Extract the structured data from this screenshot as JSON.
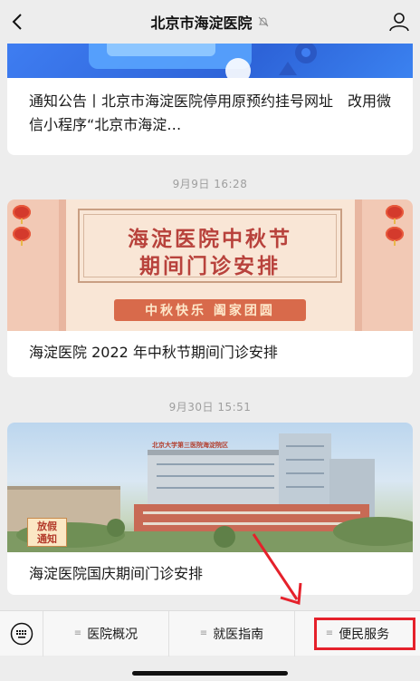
{
  "header": {
    "title": "北京市海淀医院",
    "back_icon": "back-chevron-icon",
    "mute_icon": "bell-off-icon",
    "profile_icon": "person-icon"
  },
  "feed": {
    "posts": [
      {
        "title": "通知公告丨北京市海淀医院停用原预约挂号网址　改用微信小程序“北京市海淀…"
      },
      {
        "time": "9月9日 16:28",
        "banner": {
          "headline_line1": "海淀医院中秋节",
          "headline_line2": "期间门诊安排",
          "ribbon": "中秋快乐 阖家团圆"
        },
        "title": "海淀医院 2022 年中秋节期间门诊安排"
      },
      {
        "time": "9月30日 15:51",
        "banner": {
          "sign_text": "北京大学第三医院海淀院区",
          "tag_line1": "放假",
          "tag_line2": "通知"
        },
        "title": "海淀医院国庆期间门诊安排"
      }
    ]
  },
  "menu": {
    "keyboard_icon": "keyboard-icon",
    "items": [
      {
        "label": "医院概况"
      },
      {
        "label": "就医指南"
      },
      {
        "label": "便民服务"
      }
    ]
  },
  "colors": {
    "annotation_red": "#e5212b",
    "background": "#ededed"
  }
}
